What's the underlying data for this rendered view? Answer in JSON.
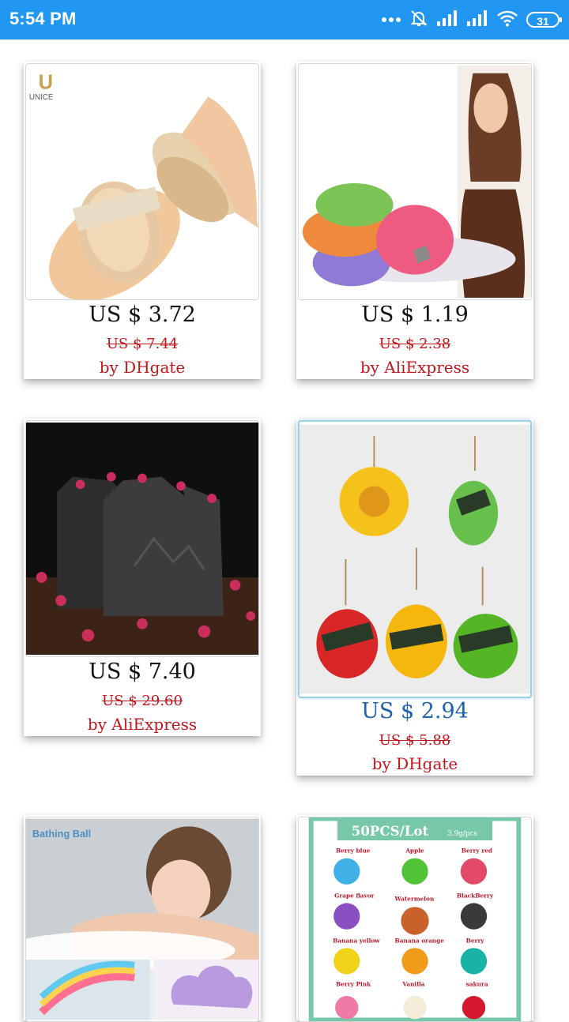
{
  "status": {
    "time": "5:54 PM",
    "battery": "31"
  },
  "products": [
    {
      "price": "US $ 3.72",
      "old_price": "US $ 7.44",
      "seller": "by DHgate",
      "brand": "UNICE",
      "image": "wooden-body-brush"
    },
    {
      "price": "US $ 1.19",
      "old_price": "US $ 2.38",
      "seller": "by AliExpress",
      "image": "shampoo-bars-hair"
    },
    {
      "price": "US $ 7.40",
      "old_price": "US $ 29.60",
      "seller": "by AliExpress",
      "image": "charcoal-rose-soap"
    },
    {
      "price": "US $ 2.94",
      "old_price": "US $ 5.88",
      "seller": "by DHgate",
      "image": "fruit-rope-soaps"
    },
    {
      "price": "",
      "old_price": "",
      "seller": "",
      "image_label": "Bathing Ball",
      "image": "bathing-ball"
    },
    {
      "price": "",
      "old_price": "",
      "seller": "",
      "image_label": "50PCS/Lot",
      "image_sub": "3.9g/pcs",
      "image": "bath-pearls",
      "flavors": [
        "Berry blue",
        "Apple",
        "Berry red",
        "Grape flavor",
        "Watermelon",
        "BlackBerry",
        "Banana yellow",
        "Banana orange",
        "Berry",
        "Berry Pink",
        "Vanilla",
        "sakura"
      ]
    }
  ],
  "colors": {
    "status_bar": "#2196F3",
    "price_active": "#1e62b0",
    "sale_red": "#c3151c"
  }
}
